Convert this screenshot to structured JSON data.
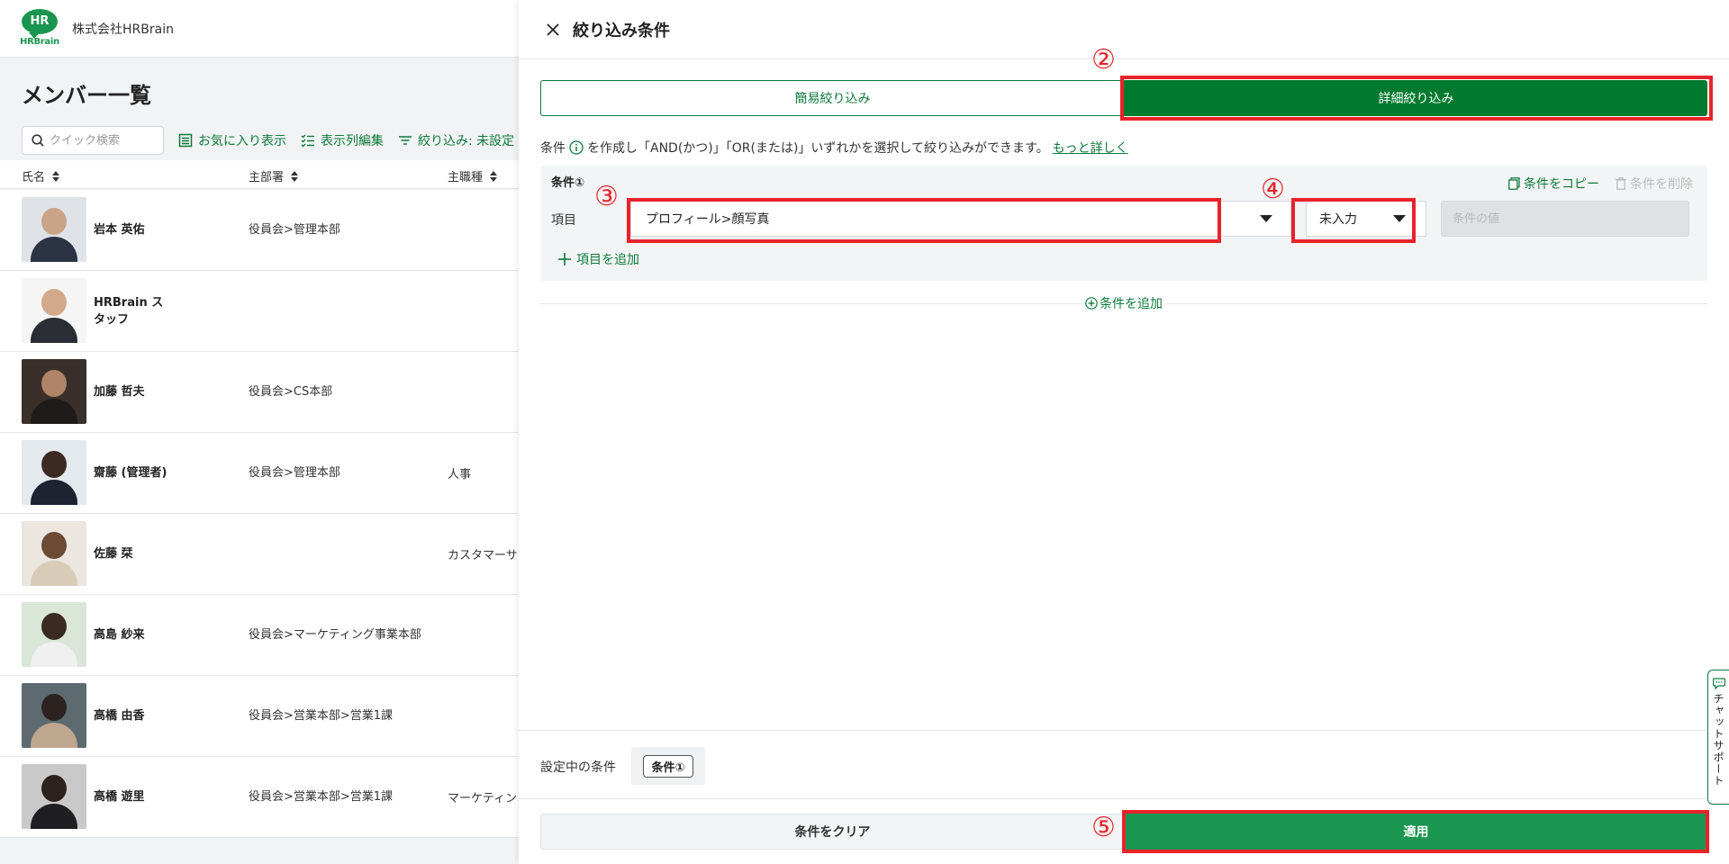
{
  "header": {
    "logo_text": "HR",
    "logo_sub": "HRBrain",
    "company": "株式会社HRBrain"
  },
  "page": {
    "title": "メンバー一覧"
  },
  "toolbar": {
    "search_placeholder": "クイック検索",
    "favorites_label": "お気に入り表示",
    "columns_label": "表示列編集",
    "filter_label": "絞り込み: 未設定"
  },
  "table": {
    "columns": [
      "氏名",
      "主部署",
      "主職種"
    ],
    "rows": [
      {
        "name": "岩本 英佑",
        "dept": "役員会>管理本部",
        "job": ""
      },
      {
        "name": "HRBrain スタッフ",
        "dept": "",
        "job": ""
      },
      {
        "name": "加藤 哲夫",
        "dept": "役員会>CS本部",
        "job": ""
      },
      {
        "name": "齋藤 (管理者)",
        "dept": "役員会>管理本部",
        "job": "人事"
      },
      {
        "name": "佐藤 栞",
        "dept": "",
        "job": "カスタマーサ"
      },
      {
        "name": "高島 紗来",
        "dept": "役員会>マーケティング事業本部",
        "job": ""
      },
      {
        "name": "高橋 由香",
        "dept": "役員会>営業本部>営業1課",
        "job": ""
      },
      {
        "name": "高橋 遊里",
        "dept": "役員会>営業本部>営業1課",
        "job": "マーケティン"
      }
    ]
  },
  "drawer": {
    "title": "絞り込み条件",
    "tabs": {
      "simple": "簡易絞り込み",
      "detailed": "詳細絞り込み"
    },
    "hint_prefix": "条件",
    "hint_body": "を作成し「AND(かつ)」「OR(または)」いずれかを選択して絞り込みができます。",
    "hint_link": "もっと詳しく",
    "condition": {
      "title": "条件①",
      "copy_label": "条件をコピー",
      "delete_label": "条件を削除",
      "field_label": "項目",
      "field_value": "プロフィール>顔写真",
      "operator_value": "未入力",
      "value_placeholder": "条件の値",
      "add_item_label": "項目を追加"
    },
    "add_condition_label": "条件を追加",
    "current_label": "設定中の条件",
    "current_chip": "条件①",
    "clear_label": "条件をクリア",
    "apply_label": "適用"
  },
  "annotations": {
    "n2": "②",
    "n3": "③",
    "n4": "④",
    "n5": "⑤"
  },
  "chat": {
    "label": "チャットサポート"
  },
  "colors": {
    "brand_green": "#007a2e",
    "apply_green": "#1a9650",
    "annotation_red": "#e8232a"
  }
}
